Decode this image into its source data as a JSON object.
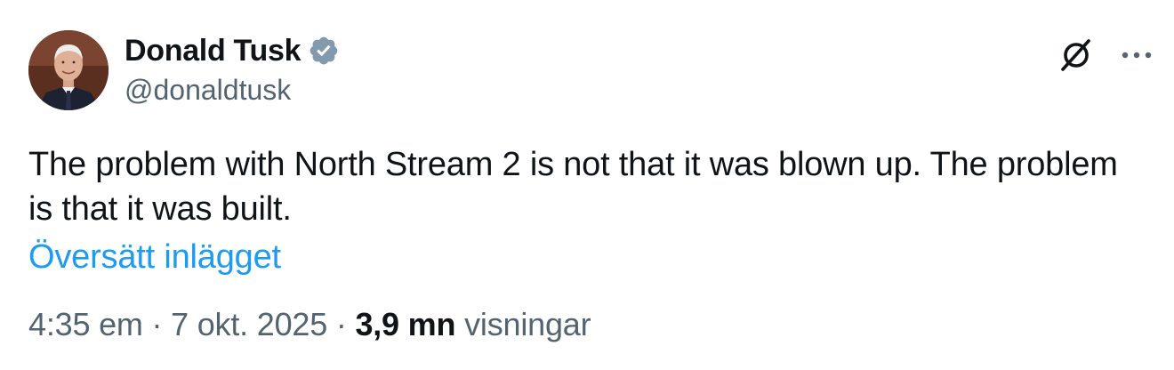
{
  "author": {
    "display_name": "Donald Tusk",
    "handle": "@donaldtusk",
    "verified": true
  },
  "icons": {
    "verified": "verified-badge-icon",
    "grok": "grok-icon",
    "more": "more-options-icon"
  },
  "tweet": {
    "text": "The problem with North Stream 2 is not that it was blown up. The problem is that it was built.",
    "translate_label": "Översätt inlägget"
  },
  "meta": {
    "time": "4:35 em",
    "separator1": " · ",
    "date": "7 okt. 2025",
    "separator2": " · ",
    "views_count": "3,9 mn",
    "views_label": " visningar"
  },
  "colors": {
    "text": "#0f1419",
    "secondary": "#536471",
    "link": "#1d9bf0"
  }
}
